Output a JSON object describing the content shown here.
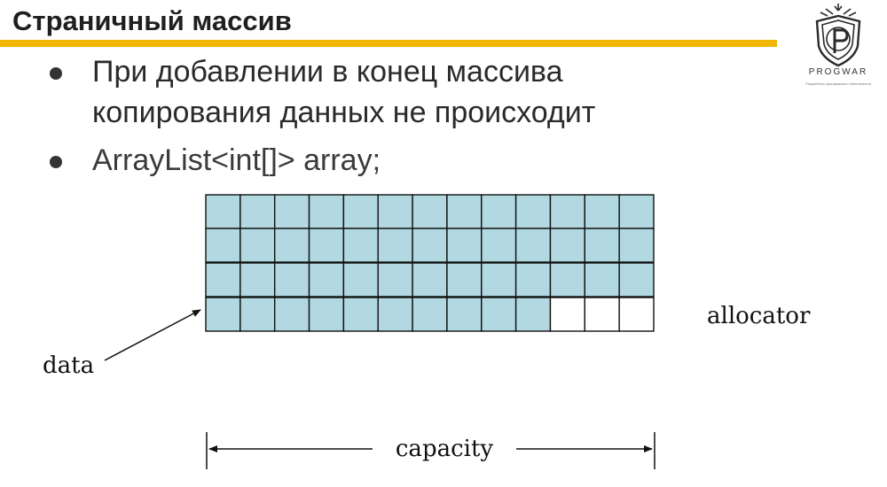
{
  "slide": {
    "title": "Страничный массив",
    "bullets": [
      [
        "При добавлении в конец массива",
        "копирования данных не происходит"
      ],
      [
        "ArrayList<int[]> array;"
      ]
    ]
  },
  "logo": {
    "name": "PROGWAR",
    "tagline": "Разработка программного обеспечения"
  },
  "diagram": {
    "label_data": "data",
    "label_allocator": "allocator",
    "label_capacity": "capacity",
    "rows": 4,
    "cols": 13,
    "filled_in_last_row": 10,
    "fill_color": "#b2d8e1",
    "empty_color": "#ffffff"
  },
  "colors": {
    "accent": "#f2b705"
  }
}
